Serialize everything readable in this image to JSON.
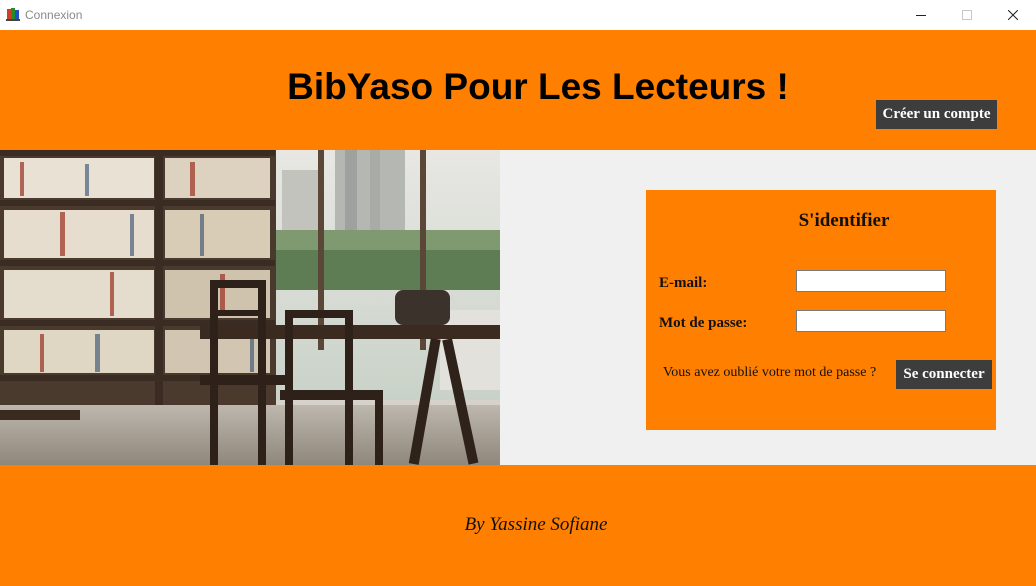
{
  "window": {
    "title": "Connexion",
    "app_icon": "app-icon",
    "controls": [
      "minimize-icon",
      "maximize-icon",
      "close-icon"
    ]
  },
  "header": {
    "title": "BibYaso Pour Les Lecteurs !",
    "create_account_label": "Créer un compte"
  },
  "photo": {
    "subject": "library-interior-image"
  },
  "login": {
    "title": "S'identifier",
    "email_label": "E-mail:",
    "email_value": "",
    "password_label": "Mot de passe:",
    "password_value": "",
    "forgot_label": "Vous avez oublié votre mot de passe ?",
    "submit_label": "Se connecter"
  },
  "footer": {
    "author": "By Yassine Sofiane"
  },
  "colors": {
    "accent": "#ff7f00",
    "button": "#3d3d3d",
    "background": "#f0f0f0"
  }
}
